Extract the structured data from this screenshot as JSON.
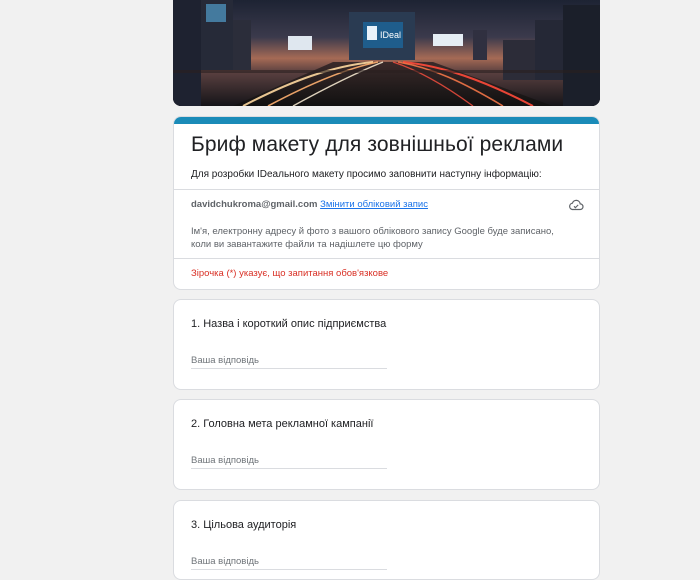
{
  "form": {
    "title": "Бриф макету для зовнішньої реклами",
    "description": "Для розробки IDеального макету просимо заповнити наступну інформацію:",
    "accent_color": "#1a8bb8"
  },
  "account": {
    "email": "davidchukroma@gmail.com",
    "switch_label": "Змінити обліковий запис",
    "note": "Ім'я, електронну адресу й фото з вашого облікового запису Google буде записано, коли ви завантажите файли та надішлете цю форму",
    "cloud_icon": "cloud-saved-icon"
  },
  "required_note": "Зірочка (*) указує, що запитання обов'язкове",
  "banner": {
    "billboard_text": "IDeal"
  },
  "questions": [
    {
      "title": "1. Назва і короткий опис підприємства",
      "placeholder": "Ваша відповідь"
    },
    {
      "title": "2. Головна мета рекламної кампанії",
      "placeholder": "Ваша відповідь"
    },
    {
      "title": "3. Цільова аудиторія",
      "placeholder": "Ваша відповідь"
    }
  ]
}
